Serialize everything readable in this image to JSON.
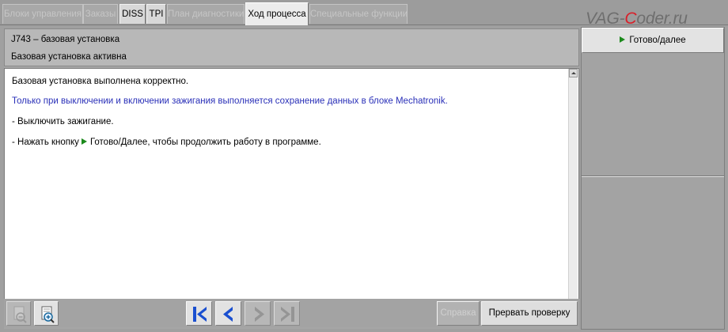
{
  "tabs": [
    {
      "label": "Блоки управления",
      "state": "disabled"
    },
    {
      "label": "Заказы",
      "state": "disabled"
    },
    {
      "label": "DISS",
      "state": "enabled"
    },
    {
      "label": "TPI",
      "state": "enabled"
    },
    {
      "label": "План диагностики",
      "state": "disabled"
    },
    {
      "label": "Ход процесса",
      "state": "active"
    },
    {
      "label": "Специальные функции",
      "state": "disabled"
    }
  ],
  "watermark": {
    "text_before": "VAG-",
    "text_red": "C",
    "text_after": "oder.ru"
  },
  "header": {
    "title": "J743 – базовая установка",
    "status": "Базовая установка активна"
  },
  "content": {
    "line1": "Базовая установка выполнена корректно.",
    "line2": "Только при выключении и включении зажигания выполняется сохранение данных в блоке Mechatronik.",
    "line3": "- Выключить зажигание.",
    "line4_before": "- Нажать кнопку",
    "line4_after": "Готово/Далее, чтобы продолжить работу в программе."
  },
  "toolbar": {
    "zoom_out_icon": "zoom-out-icon",
    "zoom_in_icon": "zoom-in-icon",
    "first_icon": "skip-first-icon",
    "prev_icon": "chevron-left-icon",
    "next_icon": "chevron-right-icon",
    "last_icon": "skip-last-icon",
    "help_label": "Справка",
    "abort_label": "Прервать проверку"
  },
  "right_panel": {
    "done_label": "Готово/далее"
  },
  "colors": {
    "info_text": "#2a30b8",
    "play_green": "#1c8a1c",
    "nav_blue": "#1a4fd0",
    "logo_red": "#d8202a"
  }
}
